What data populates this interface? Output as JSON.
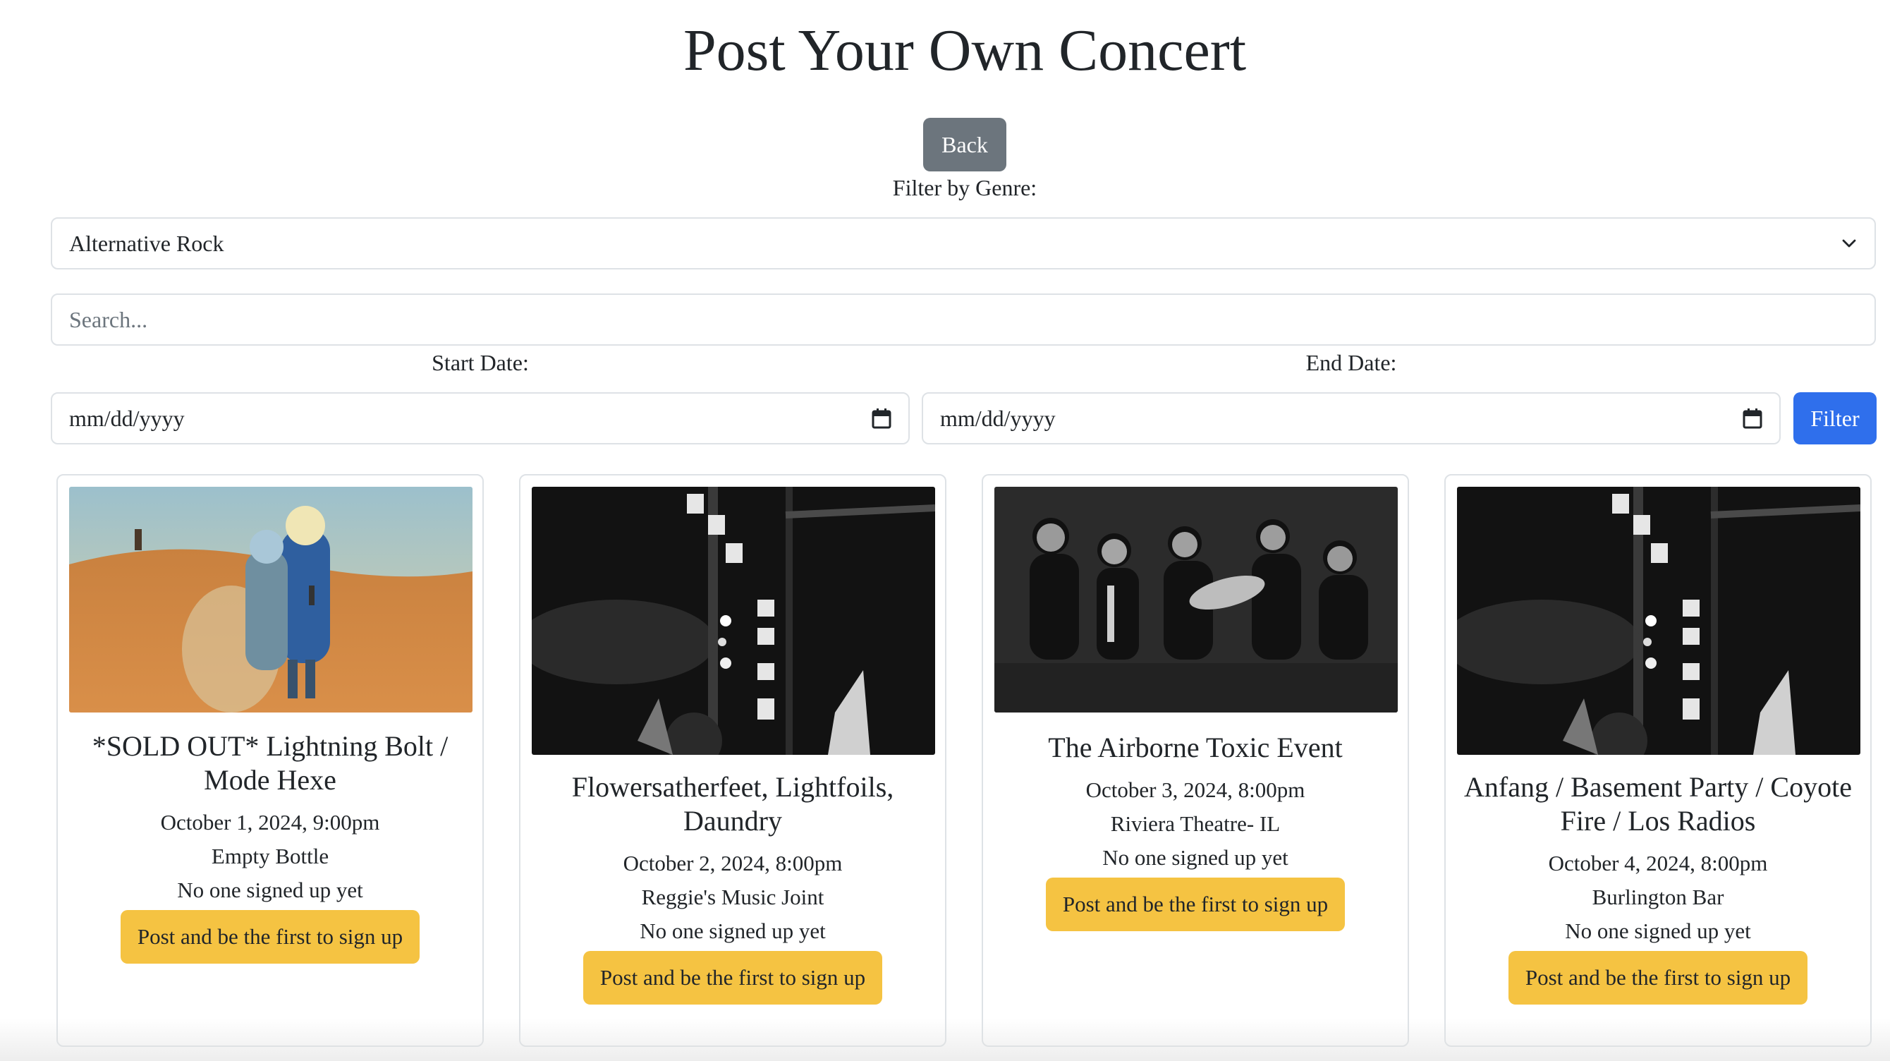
{
  "header": {
    "title": "Post Your Own Concert",
    "back_label": "Back"
  },
  "filters": {
    "genre_label": "Filter by Genre:",
    "genre_selected": "Alternative Rock",
    "search_placeholder": "Search...",
    "start_label": "Start Date:",
    "end_label": "End Date:",
    "start_value": "mm/dd/yyyy",
    "end_value": "mm/dd/yyyy",
    "filter_label": "Filter"
  },
  "icons": {
    "dropdown": "chevron-down-icon",
    "calendar": "calendar-icon"
  },
  "colors": {
    "back": "#6c757d",
    "filter": "#2f6fec",
    "signup": "#f5c342"
  },
  "concerts": [
    {
      "title": "*SOLD OUT* Lightning Bolt / Mode Hexe",
      "date": "October 1, 2024, 9:00pm",
      "venue": "Empty Bottle",
      "signups": "No one signed up yet",
      "button": "Post and be the first to sign up"
    },
    {
      "title": "Flowersatherfeet, Lightfoils, Daundry",
      "date": "October 2, 2024, 8:00pm",
      "venue": "Reggie's Music Joint",
      "signups": "No one signed up yet",
      "button": "Post and be the first to sign up"
    },
    {
      "title": "The Airborne Toxic Event",
      "date": "October 3, 2024, 8:00pm",
      "venue": "Riviera Theatre- IL",
      "signups": "No one signed up yet",
      "button": "Post and be the first to sign up"
    },
    {
      "title": "Anfang / Basement Party / Coyote Fire / Los Radios",
      "date": "October 4, 2024, 8:00pm",
      "venue": "Burlington Bar",
      "signups": "No one signed up yet",
      "button": "Post and be the first to sign up"
    }
  ]
}
